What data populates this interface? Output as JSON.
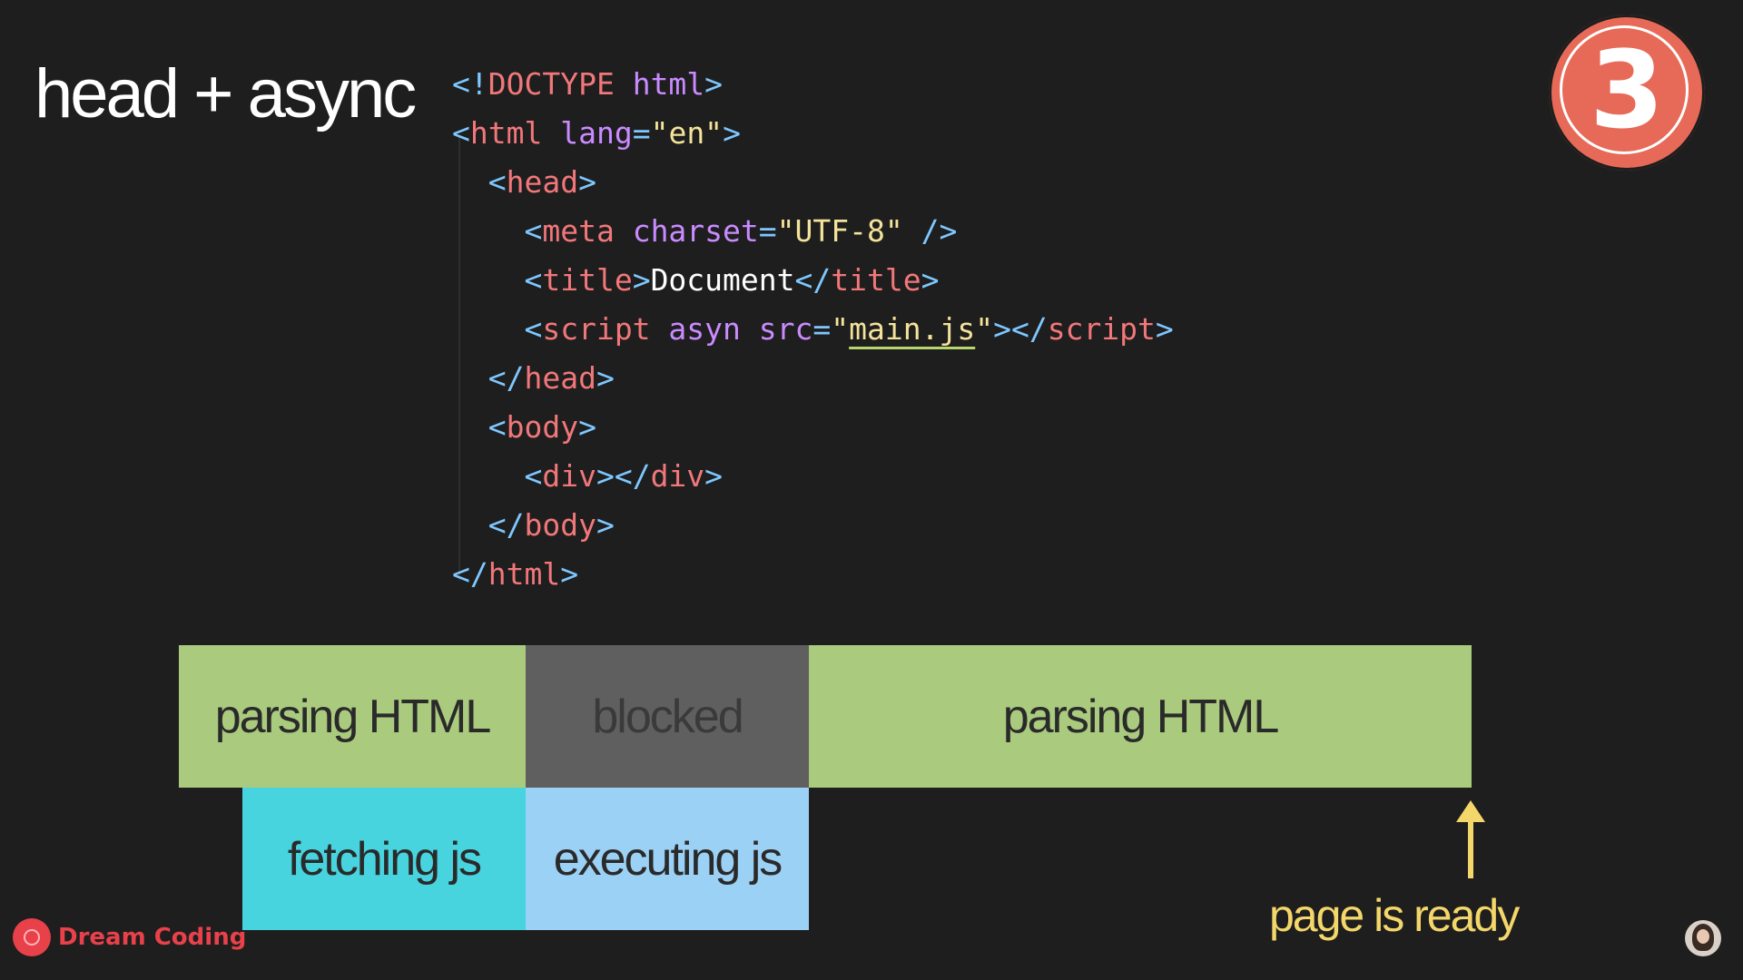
{
  "title": "head + async",
  "badge": {
    "number": "3",
    "color": "#e66a57"
  },
  "code": {
    "lines": [
      [
        {
          "t": "<!",
          "c": "punct"
        },
        {
          "t": "DOCTYPE",
          "c": "tag"
        },
        {
          "t": " html",
          "c": "attr"
        },
        {
          "t": ">",
          "c": "punct"
        }
      ],
      [
        {
          "t": "<",
          "c": "punct"
        },
        {
          "t": "html",
          "c": "tag"
        },
        {
          "t": " lang",
          "c": "attr"
        },
        {
          "t": "=",
          "c": "punct"
        },
        {
          "t": "\"en\"",
          "c": "str"
        },
        {
          "t": ">",
          "c": "punct"
        }
      ],
      [
        {
          "t": "  <",
          "c": "punct"
        },
        {
          "t": "head",
          "c": "tag"
        },
        {
          "t": ">",
          "c": "punct"
        }
      ],
      [
        {
          "t": "    <",
          "c": "punct"
        },
        {
          "t": "meta",
          "c": "tag"
        },
        {
          "t": " charset",
          "c": "attr"
        },
        {
          "t": "=",
          "c": "punct"
        },
        {
          "t": "\"UTF-8\"",
          "c": "str"
        },
        {
          "t": " />",
          "c": "punct"
        }
      ],
      [
        {
          "t": "    <",
          "c": "punct"
        },
        {
          "t": "title",
          "c": "tag"
        },
        {
          "t": ">",
          "c": "punct"
        },
        {
          "t": "Document",
          "c": "text"
        },
        {
          "t": "</",
          "c": "punct"
        },
        {
          "t": "title",
          "c": "tag"
        },
        {
          "t": ">",
          "c": "punct"
        }
      ],
      [
        {
          "t": "    <",
          "c": "punct"
        },
        {
          "t": "script",
          "c": "tag"
        },
        {
          "t": " asyn",
          "c": "attr"
        },
        {
          "t": " src",
          "c": "attr"
        },
        {
          "t": "=",
          "c": "punct"
        },
        {
          "t": "\"",
          "c": "str"
        },
        {
          "t": "main.js",
          "c": "str",
          "u": true
        },
        {
          "t": "\"",
          "c": "str"
        },
        {
          "t": "></",
          "c": "punct"
        },
        {
          "t": "script",
          "c": "tag"
        },
        {
          "t": ">",
          "c": "punct"
        }
      ],
      [
        {
          "t": "  </",
          "c": "punct"
        },
        {
          "t": "head",
          "c": "tag"
        },
        {
          "t": ">",
          "c": "punct"
        }
      ],
      [
        {
          "t": "  <",
          "c": "punct"
        },
        {
          "t": "body",
          "c": "tag"
        },
        {
          "t": ">",
          "c": "punct"
        }
      ],
      [
        {
          "t": "    <",
          "c": "punct"
        },
        {
          "t": "div",
          "c": "tag"
        },
        {
          "t": "></",
          "c": "punct"
        },
        {
          "t": "div",
          "c": "tag"
        },
        {
          "t": ">",
          "c": "punct"
        }
      ],
      [
        {
          "t": "  </",
          "c": "punct"
        },
        {
          "t": "body",
          "c": "tag"
        },
        {
          "t": ">",
          "c": "punct"
        }
      ],
      [
        {
          "t": "</",
          "c": "punct"
        },
        {
          "t": "html",
          "c": "tag"
        },
        {
          "t": ">",
          "c": "punct"
        }
      ]
    ]
  },
  "timeline": {
    "parsing_html_1": "parsing HTML",
    "blocked": "blocked",
    "parsing_html_2": "parsing HTML",
    "fetching_js": "fetching js",
    "executing_js": "executing js",
    "page_ready": "page is ready",
    "colors": {
      "parsing": "#aacb7e",
      "blocked": "#5f5f5f",
      "fetching": "#47d4df",
      "executing": "#9bd1f5",
      "arrow": "#f4d76a"
    }
  },
  "branding": {
    "name": "Dream Coding",
    "color": "#e8414a"
  }
}
